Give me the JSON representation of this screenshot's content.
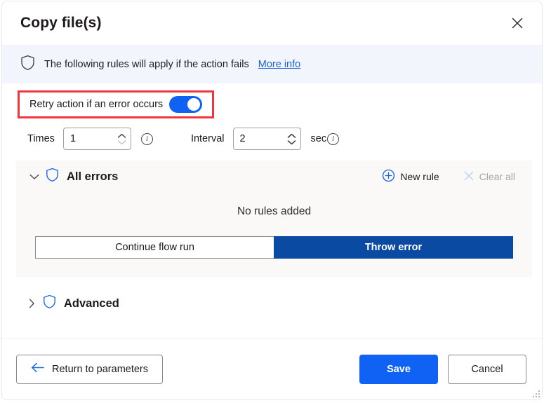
{
  "window": {
    "title": "Copy file(s)",
    "close_icon": "close-icon"
  },
  "banner": {
    "shield_icon": "shield-icon",
    "text": "The following rules will apply if the action fails",
    "link_label": "More info"
  },
  "retry": {
    "label": "Retry action if an error occurs",
    "toggle_state": "on",
    "highlight_color": "#f0353c",
    "toggle_color": "#1062f5"
  },
  "retry_settings": {
    "times_label": "Times",
    "times_value": "1",
    "times_info_icon": "info-icon",
    "interval_label": "Interval",
    "interval_value": "2",
    "interval_unit": "sec",
    "interval_info_icon": "info-icon"
  },
  "errors_panel": {
    "collapse_icon": "chevron-down-icon",
    "shield_icon": "shield-icon",
    "title": "All errors",
    "new_rule_label": "New rule",
    "new_rule_icon": "circle-plus-icon",
    "clear_all_label": "Clear all",
    "clear_all_icon": "close-icon",
    "clear_all_disabled": true,
    "empty_text": "No rules added",
    "segmented": {
      "options": [
        {
          "label": "Continue flow run",
          "selected": false
        },
        {
          "label": "Throw error",
          "selected": true
        }
      ],
      "selected_color": "#0b4aa2"
    }
  },
  "advanced": {
    "expand_icon": "chevron-right-icon",
    "shield_icon": "shield-icon",
    "title": "Advanced"
  },
  "footer": {
    "return_label": "Return to parameters",
    "return_icon": "arrow-left-icon",
    "save_label": "Save",
    "cancel_label": "Cancel",
    "primary_color": "#1062f5"
  }
}
